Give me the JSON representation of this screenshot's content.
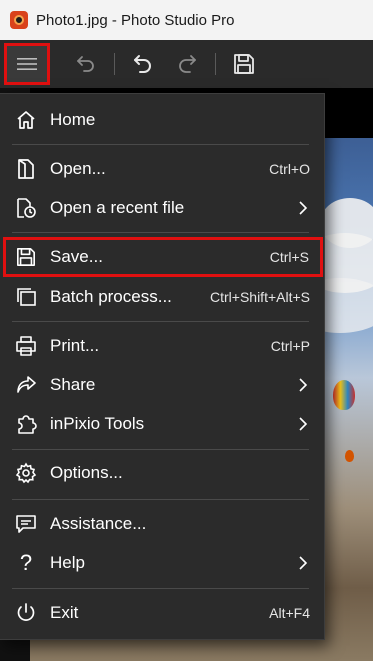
{
  "window": {
    "title": "Photo1.jpg - Photo Studio Pro"
  },
  "toolbar": {
    "buttons": [
      {
        "name": "menu",
        "icon": "hamburger-icon",
        "highlighted": true
      },
      {
        "name": "back",
        "icon": "back-arrow-icon"
      },
      {
        "name": "undo",
        "icon": "undo-icon"
      },
      {
        "name": "redo",
        "icon": "redo-icon"
      },
      {
        "name": "save",
        "icon": "save-icon"
      }
    ]
  },
  "menu": {
    "items": [
      {
        "label": "Home",
        "icon": "home-icon",
        "shortcut": "",
        "submenu": false
      },
      {
        "label": "Open...",
        "icon": "open-file-icon",
        "shortcut": "Ctrl+O",
        "submenu": false
      },
      {
        "label": "Open a recent file",
        "icon": "recent-file-icon",
        "shortcut": "",
        "submenu": true
      },
      {
        "label": "Save...",
        "icon": "save-icon",
        "shortcut": "Ctrl+S",
        "submenu": false,
        "highlighted": true
      },
      {
        "label": "Batch process...",
        "icon": "batch-icon",
        "shortcut": "Ctrl+Shift+Alt+S",
        "submenu": false
      },
      {
        "label": "Print...",
        "icon": "print-icon",
        "shortcut": "Ctrl+P",
        "submenu": false
      },
      {
        "label": "Share",
        "icon": "share-icon",
        "shortcut": "",
        "submenu": true
      },
      {
        "label": "inPixio Tools",
        "icon": "puzzle-icon",
        "shortcut": "",
        "submenu": true
      },
      {
        "label": "Options...",
        "icon": "gear-icon",
        "shortcut": "",
        "submenu": false
      },
      {
        "label": "Assistance...",
        "icon": "chat-icon",
        "shortcut": "",
        "submenu": false
      },
      {
        "label": "Help",
        "icon": "help-icon",
        "shortcut": "",
        "submenu": true
      },
      {
        "label": "Exit",
        "icon": "power-icon",
        "shortcut": "Alt+F4",
        "submenu": false
      }
    ]
  },
  "colors": {
    "highlight": "#e01010",
    "menu_bg": "#2b2b2b",
    "titlebar_bg": "#f3f3f3",
    "toolbar_bg": "#2a2a2a"
  }
}
